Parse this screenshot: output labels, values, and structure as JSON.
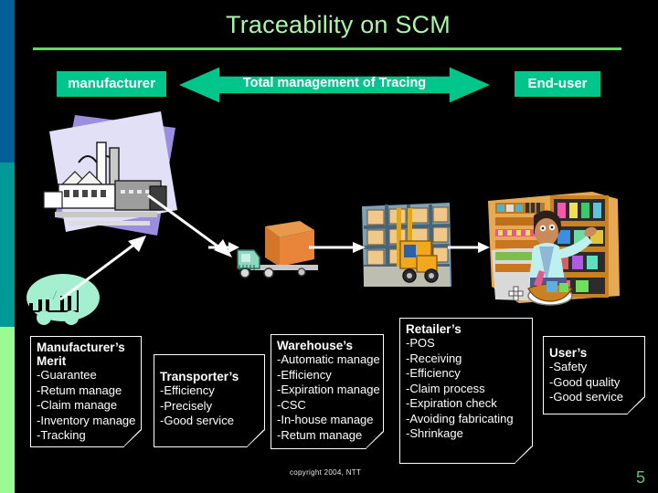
{
  "slide": {
    "title": "Traceability on SCM",
    "page_number": "5",
    "copyright": "copyright 2004, NTT",
    "background_color": "#000000",
    "title_color": "#A9F5A9",
    "accent_green": "#00C68C",
    "rule_color": "#62D962"
  },
  "rail": {
    "bands": [
      {
        "name": "blue",
        "color": "#005F96"
      },
      {
        "name": "teal",
        "color": "#009A96"
      },
      {
        "name": "green",
        "color": "#9CFA95"
      }
    ]
  },
  "banner": {
    "left_label": "manufacturer",
    "right_label": "End-user",
    "arrow_label": "Total management of Tracing"
  },
  "artwork": [
    {
      "name": "factory-clipart",
      "caption": "factory building on lavender panels"
    },
    {
      "name": "delivery-truck-clipart",
      "caption": "truck carrying orange carton"
    },
    {
      "name": "warehouse-forklift-clipart",
      "caption": "forklift in racking warehouse"
    },
    {
      "name": "retail-shopper-clipart",
      "caption": "shopper picking goods from store shelves"
    },
    {
      "name": "mint-truck-clipart",
      "caption": "mint green truck silhouette"
    }
  ],
  "notes": [
    {
      "id": "manufacturer",
      "heading": [
        "Manufacturer’s",
        "Merit"
      ],
      "items": [
        "-Guarantee",
        "-Retum manage",
        "-Claim manage",
        "-Inventory manage",
        "-Tracking"
      ]
    },
    {
      "id": "transporter",
      "heading": [
        "Transporter’s"
      ],
      "items": [
        "-Efficiency",
        "-Precisely",
        "-Good service"
      ]
    },
    {
      "id": "warehouse",
      "heading": [
        "Warehouse’s"
      ],
      "items": [
        "-Automatic manage",
        "-Efficiency",
        "-Expiration manage",
        "-CSC",
        "-In-house manage",
        "-Retum manage"
      ]
    },
    {
      "id": "retailer",
      "heading": [
        "Retailer’s"
      ],
      "items": [
        "-POS",
        "-Receiving",
        "-Efficiency",
        "-Claim process",
        "-Expiration check",
        "-Avoiding fabricating",
        "-Shrinkage"
      ]
    },
    {
      "id": "user",
      "heading": [
        "User’s"
      ],
      "items": [
        "-Safety",
        "-Good quality",
        "-Good service"
      ]
    }
  ]
}
